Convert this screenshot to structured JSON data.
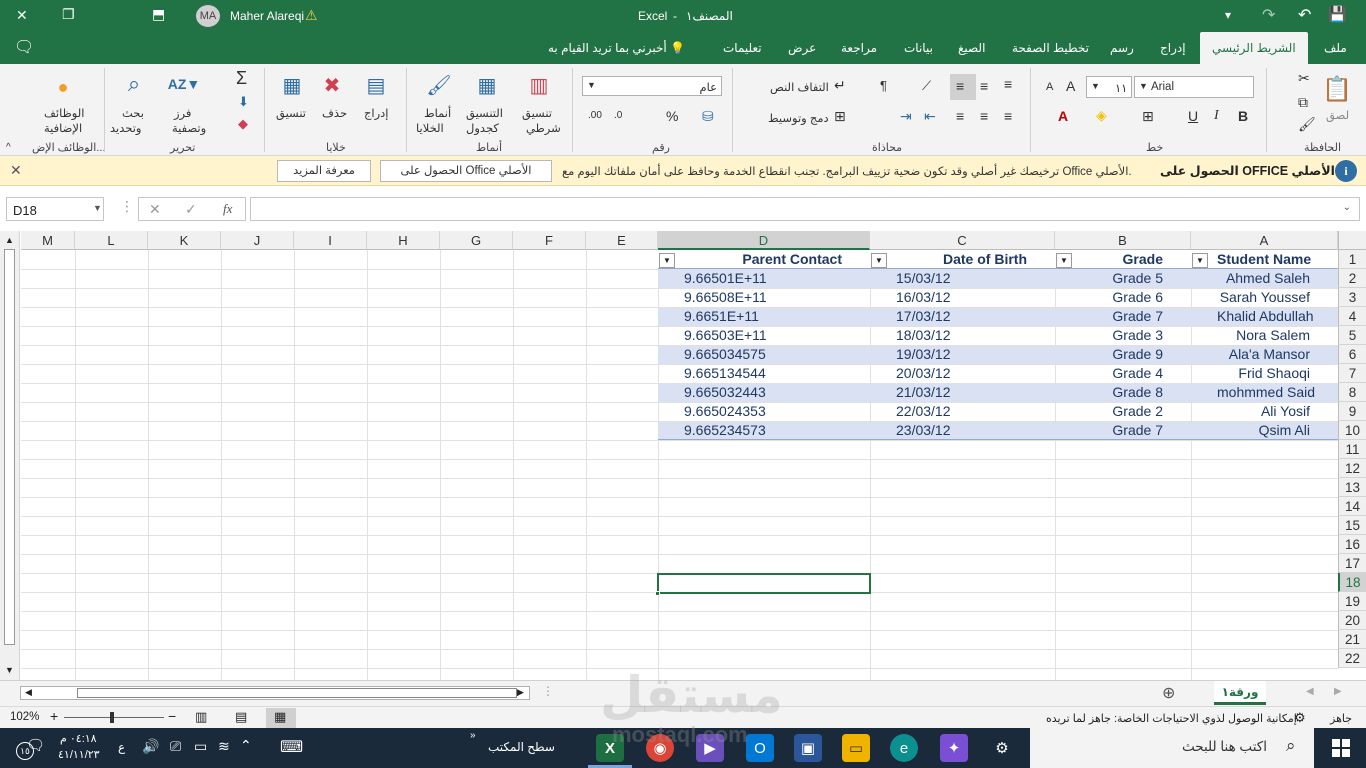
{
  "titlebar": {
    "app": "Excel",
    "sep": "-",
    "document": "المصنف١",
    "user": "Maher Alareqi",
    "avatar": "MA",
    "close": "✕",
    "restore": "❐",
    "ribbon_toggle": "⬒",
    "warning": "⚠",
    "qat_more": "▾",
    "redo": "↷",
    "undo": "↶",
    "save": "💾"
  },
  "tabs": [
    "ملف",
    "الشريط الرئيسي",
    "إدراج",
    "رسم",
    "تخطيط الصفحة",
    "الصيغ",
    "بيانات",
    "مراجعة",
    "عرض",
    "تعليمات"
  ],
  "tell_me": "أخبرني بما تريد القيام به",
  "ribbon": {
    "clipboard": {
      "label": "الحافظة",
      "paste": "لصق"
    },
    "font": {
      "label": "خط",
      "name": "Arial",
      "size": "١١",
      "bold": "B",
      "italic": "I",
      "underline": "U",
      "grow": "A",
      "shrink": "A"
    },
    "alignment": {
      "label": "محاذاة",
      "wrap": "التفاف النص",
      "merge": "دمج وتوسيط"
    },
    "number": {
      "label": "رقم",
      "format": "عام",
      "percent": "%"
    },
    "styles": {
      "label": "أنماط",
      "conditional_1": "تنسيق",
      "conditional_2": "شرطي",
      "table_1": "التنسيق",
      "table_2": "كجدول",
      "cell_1": "أنماط",
      "cell_2": "الخلايا"
    },
    "cells": {
      "label": "خلايا",
      "insert": "إدراج",
      "delete": "حذف",
      "format": "تنسيق"
    },
    "editing": {
      "label": "تحرير",
      "sort_1": "فرز",
      "sort_2": "وتصفية",
      "find_1": "بحث",
      "find_2": "وتحديد",
      "sigma": "Σ"
    },
    "addins": {
      "label": "الوظائف الإض...",
      "name_1": "الوظائف",
      "name_2": "الإضافية"
    }
  },
  "warning_bar": {
    "title": "الحصول على OFFICE الأصلي",
    "message": "ترخيصك غير أصلي وقد تكون ضحية تزييف البرامج. تجنب انقطاع الخدمة وحافظ على أمان ملفاتك اليوم مع Office الأصلي.",
    "btn_get": "الحصول على Office الأصلي",
    "btn_more": "معرفة المزيد",
    "info": "i",
    "close": "✕"
  },
  "formula_bar": {
    "name_box": "D18",
    "cancel": "✕",
    "enter": "✓",
    "fx": "fx",
    "value": ""
  },
  "columns": [
    "A",
    "B",
    "C",
    "D",
    "E",
    "F",
    "G",
    "H",
    "I",
    "J",
    "K",
    "L",
    "M"
  ],
  "rows": [
    "1",
    "2",
    "3",
    "4",
    "5",
    "6",
    "7",
    "8",
    "9",
    "10",
    "11",
    "12",
    "13",
    "14",
    "15",
    "16",
    "17",
    "18",
    "19",
    "20",
    "21",
    "22"
  ],
  "table": {
    "headers": [
      "Student Name",
      "Grade",
      "Date of Birth",
      "Parent Contact"
    ],
    "rows": [
      [
        "Ahmed Saleh",
        "Grade 5",
        "15/03/12",
        "9.66501E+11"
      ],
      [
        "Sarah Youssef",
        "Grade 6",
        "16/03/12",
        "9.66508E+11"
      ],
      [
        "Khalid Abdullah",
        "Grade 7",
        "17/03/12",
        "9.6651E+11"
      ],
      [
        "Nora Salem",
        "Grade 3",
        "18/03/12",
        "9.66503E+11"
      ],
      [
        "Ala'a Mansor",
        "Grade 9",
        "19/03/12",
        "9.665034575"
      ],
      [
        "Frid Shaoqi",
        "Grade 4",
        "20/03/12",
        "9.665134544"
      ],
      [
        "mohmmed Said",
        "Grade 8",
        "21/03/12",
        "9.665032443"
      ],
      [
        "Ali Yosif",
        "Grade 2",
        "22/03/12",
        "9.665024353"
      ],
      [
        "Qsim Ali",
        "Grade 7",
        "23/03/12",
        "9.665234573"
      ]
    ]
  },
  "sheet_tabs": {
    "active": "ورقة١",
    "add": "⊕"
  },
  "status": {
    "ready": "جاهز",
    "accessibility": "إمكانية الوصول لذوي الاحتياجات الخاصة: جاهز لما تريده",
    "zoom": "102%"
  },
  "taskbar": {
    "search": "اكتب هنا للبحث",
    "desktop": "سطح المكتب",
    "time": "٠٤:١٨ م",
    "date": "٤١/١١/٢٣",
    "lang": "ع",
    "notif": "١٥"
  },
  "watermark": {
    "line1": "مستقل",
    "line2": "mostaql.com"
  }
}
